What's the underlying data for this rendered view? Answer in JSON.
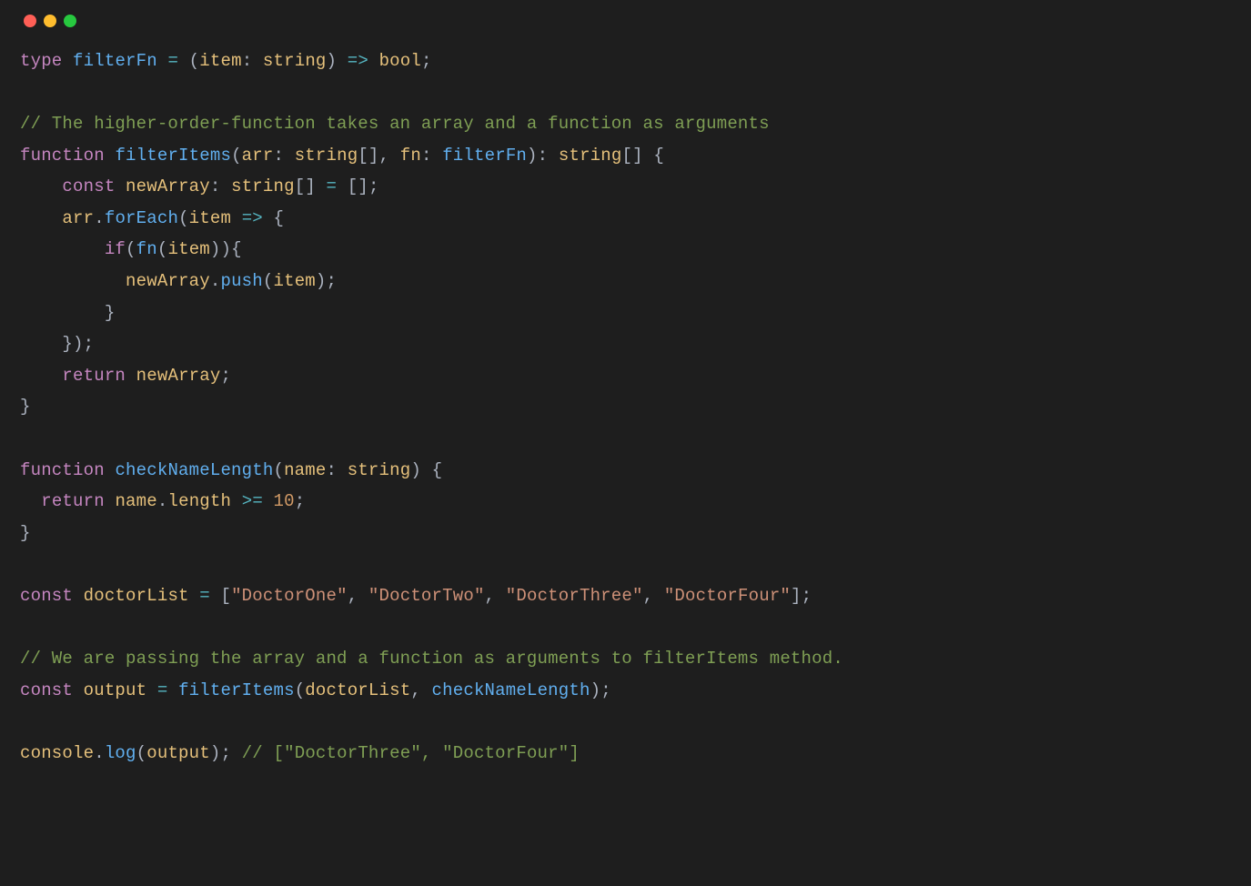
{
  "titlebar": {
    "dots": [
      "red",
      "yellow",
      "green"
    ]
  },
  "tokens": {
    "type": "type",
    "function": "function",
    "const": "const",
    "return": "return",
    "if": "if",
    "filterFn": "filterFn",
    "item": "item",
    "string": "string",
    "bool": "bool",
    "filterItems": "filterItems",
    "arr": "arr",
    "fn": "fn",
    "newArray": "newArray",
    "forEach": "forEach",
    "push": "push",
    "checkNameLength": "checkNameLength",
    "name": "name",
    "length": "length",
    "doctorList": "doctorList",
    "output": "output",
    "console": "console",
    "log": "log",
    "eq": " = ",
    "arrow": " => ",
    "colon": ": ",
    "colon_nospace": ":",
    "gte": " >= ",
    "ten": "10",
    "lbrace": "{",
    "rbrace": "}",
    "lparen": "(",
    "rparen": ")",
    "lbrack": "[",
    "rbrack": "]",
    "semi": ";",
    "comma": ", ",
    "comma_nospace": ",",
    "dot": ".",
    "bracks": "[]",
    "emptyarr": "[]",
    "space": " "
  },
  "comments": {
    "c1": "// The higher-order-function takes an array and a function as arguments",
    "c2": "// We are passing the array and a function as arguments to filterItems method.",
    "c3": "// [\"DoctorThree\", \"DoctorFour\"]"
  },
  "strings": {
    "d1": "\"DoctorOne\"",
    "d2": "\"DoctorTwo\"",
    "d3": "\"DoctorThree\"",
    "d4": "\"DoctorFour\""
  }
}
